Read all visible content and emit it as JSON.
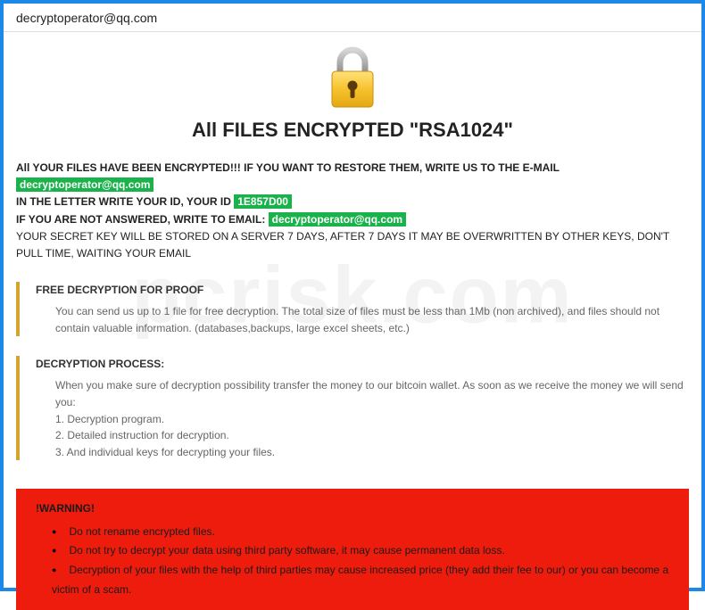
{
  "window": {
    "title": "decryptoperator@qq.com"
  },
  "icon": "lock-icon",
  "headline": "All FILES ENCRYPTED \"RSA1024\"",
  "intro": {
    "line1_a": "All YOUR FILES HAVE BEEN ENCRYPTED!!! IF YOU WANT TO RESTORE THEM, WRITE US TO THE E-MAIL ",
    "email1": "decryptoperator@qq.com",
    "line2_a": "IN THE LETTER WRITE YOUR ID, YOUR ID ",
    "id": "1E857D00",
    "line3_a": "IF YOU ARE NOT ANSWERED, WRITE TO EMAIL: ",
    "email2": "decryptoperator@qq.com",
    "line4": "YOUR SECRET KEY WILL BE STORED ON A SERVER 7 DAYS, AFTER 7 DAYS IT MAY BE OVERWRITTEN BY OTHER KEYS, DON'T PULL TIME, WAITING YOUR EMAIL"
  },
  "sections": {
    "proof": {
      "title": "FREE DECRYPTION FOR PROOF",
      "body": "You can send us up to 1 file for free decryption. The total size of files must be less than 1Mb (non archived), and files should not contain valuable information. (databases,backups, large excel sheets, etc.)"
    },
    "process": {
      "title": "DECRYPTION PROCESS:",
      "body0": "When you make sure of decryption possibility transfer the money to our bitcoin wallet. As soon as we receive the money we will send you:",
      "body1": "1. Decryption program.",
      "body2": "2. Detailed instruction for decryption.",
      "body3": "3. And individual keys for decrypting your files."
    }
  },
  "warning": {
    "title": "!WARNING!",
    "items": [
      "Do not rename encrypted files.",
      "Do not try to decrypt your data using third party software, it may cause permanent data loss.",
      "Decryption of your files with the help of third parties may cause increased price (they add their fee to our) or you can become a victim of a scam."
    ]
  },
  "watermark": "pcrisk.com"
}
